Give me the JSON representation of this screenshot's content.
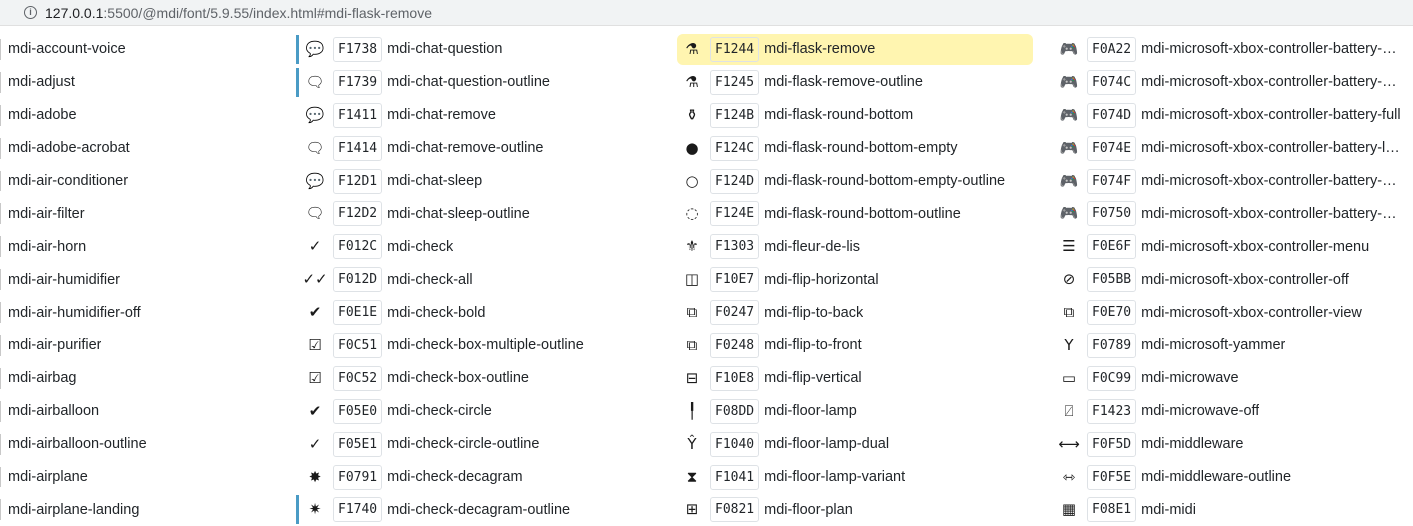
{
  "urlbar": {
    "host": "127.0.0.1",
    "rest": ":5500/@mdi/font/5.9.55/index.html#mdi-flask-remove",
    "info_icon": "info-icon"
  },
  "columns": [
    {
      "rows": [
        {
          "name": "mdi-account-voice"
        },
        {
          "name": "mdi-adjust"
        },
        {
          "name": "mdi-adobe"
        },
        {
          "name": "mdi-adobe-acrobat"
        },
        {
          "name": "mdi-air-conditioner"
        },
        {
          "name": "mdi-air-filter"
        },
        {
          "name": "mdi-air-horn"
        },
        {
          "name": "mdi-air-humidifier"
        },
        {
          "name": "mdi-air-humidifier-off"
        },
        {
          "name": "mdi-air-purifier"
        },
        {
          "name": "mdi-airbag"
        },
        {
          "name": "mdi-airballoon"
        },
        {
          "name": "mdi-airballoon-outline"
        },
        {
          "name": "mdi-airplane"
        },
        {
          "name": "mdi-airplane-landing"
        }
      ]
    },
    {
      "rows": [
        {
          "code": "F1738",
          "name": "mdi-chat-question",
          "glyph": "💬",
          "icon": "chat-question-icon",
          "marked": true
        },
        {
          "code": "F1739",
          "name": "mdi-chat-question-outline",
          "glyph": "🗨",
          "icon": "chat-question-outline-icon",
          "marked": true
        },
        {
          "code": "F1411",
          "name": "mdi-chat-remove",
          "glyph": "💬",
          "icon": "chat-remove-icon"
        },
        {
          "code": "F1414",
          "name": "mdi-chat-remove-outline",
          "glyph": "🗨",
          "icon": "chat-remove-outline-icon"
        },
        {
          "code": "F12D1",
          "name": "mdi-chat-sleep",
          "glyph": "💬",
          "icon": "chat-sleep-icon"
        },
        {
          "code": "F12D2",
          "name": "mdi-chat-sleep-outline",
          "glyph": "🗨",
          "icon": "chat-sleep-outline-icon"
        },
        {
          "code": "F012C",
          "name": "mdi-check",
          "glyph": "✓",
          "icon": "check-icon"
        },
        {
          "code": "F012D",
          "name": "mdi-check-all",
          "glyph": "✓✓",
          "icon": "check-all-icon"
        },
        {
          "code": "F0E1E",
          "name": "mdi-check-bold",
          "glyph": "✔",
          "icon": "check-bold-icon"
        },
        {
          "code": "F0C51",
          "name": "mdi-check-box-multiple-outline",
          "glyph": "☑",
          "icon": "check-box-multiple-outline-icon"
        },
        {
          "code": "F0C52",
          "name": "mdi-check-box-outline",
          "glyph": "☑",
          "icon": "check-box-outline-icon"
        },
        {
          "code": "F05E0",
          "name": "mdi-check-circle",
          "glyph": "✔",
          "icon": "check-circle-icon"
        },
        {
          "code": "F05E1",
          "name": "mdi-check-circle-outline",
          "glyph": "✓",
          "icon": "check-circle-outline-icon"
        },
        {
          "code": "F0791",
          "name": "mdi-check-decagram",
          "glyph": "✸",
          "icon": "check-decagram-icon"
        },
        {
          "code": "F1740",
          "name": "mdi-check-decagram-outline",
          "glyph": "✷",
          "icon": "check-decagram-outline-icon",
          "marked": true
        }
      ]
    },
    {
      "rows": [
        {
          "code": "F1244",
          "name": "mdi-flask-remove",
          "glyph": "⚗",
          "icon": "flask-remove-icon",
          "highlight": true
        },
        {
          "code": "F1245",
          "name": "mdi-flask-remove-outline",
          "glyph": "⚗",
          "icon": "flask-remove-outline-icon"
        },
        {
          "code": "F124B",
          "name": "mdi-flask-round-bottom",
          "glyph": "⚱",
          "icon": "flask-round-bottom-icon"
        },
        {
          "code": "F124C",
          "name": "mdi-flask-round-bottom-empty",
          "glyph": "●",
          "icon": "flask-round-bottom-empty-icon"
        },
        {
          "code": "F124D",
          "name": "mdi-flask-round-bottom-empty-outline",
          "glyph": "○",
          "icon": "flask-round-bottom-empty-outline-icon"
        },
        {
          "code": "F124E",
          "name": "mdi-flask-round-bottom-outline",
          "glyph": "◌",
          "icon": "flask-round-bottom-outline-icon"
        },
        {
          "code": "F1303",
          "name": "mdi-fleur-de-lis",
          "glyph": "⚜",
          "icon": "fleur-de-lis-icon"
        },
        {
          "code": "F10E7",
          "name": "mdi-flip-horizontal",
          "glyph": "◫",
          "icon": "flip-horizontal-icon"
        },
        {
          "code": "F0247",
          "name": "mdi-flip-to-back",
          "glyph": "⧉",
          "icon": "flip-to-back-icon"
        },
        {
          "code": "F0248",
          "name": "mdi-flip-to-front",
          "glyph": "⧉",
          "icon": "flip-to-front-icon"
        },
        {
          "code": "F10E8",
          "name": "mdi-flip-vertical",
          "glyph": "⊟",
          "icon": "flip-vertical-icon"
        },
        {
          "code": "F08DD",
          "name": "mdi-floor-lamp",
          "glyph": "╿",
          "icon": "floor-lamp-icon"
        },
        {
          "code": "F1040",
          "name": "mdi-floor-lamp-dual",
          "glyph": "Ŷ",
          "icon": "floor-lamp-dual-icon"
        },
        {
          "code": "F1041",
          "name": "mdi-floor-lamp-variant",
          "glyph": "⧗",
          "icon": "floor-lamp-variant-icon"
        },
        {
          "code": "F0821",
          "name": "mdi-floor-plan",
          "glyph": "⊞",
          "icon": "floor-plan-icon"
        }
      ]
    },
    {
      "rows": [
        {
          "code": "F0A22",
          "name": "mdi-microsoft-xbox-controller-battery-ch...",
          "glyph": "🎮",
          "icon": "xbox-controller-battery-charging-icon"
        },
        {
          "code": "F074C",
          "name": "mdi-microsoft-xbox-controller-battery-em...",
          "glyph": "🎮",
          "icon": "xbox-controller-battery-empty-icon"
        },
        {
          "code": "F074D",
          "name": "mdi-microsoft-xbox-controller-battery-full",
          "glyph": "🎮",
          "icon": "xbox-controller-battery-full-icon"
        },
        {
          "code": "F074E",
          "name": "mdi-microsoft-xbox-controller-battery-low",
          "glyph": "🎮",
          "icon": "xbox-controller-battery-low-icon"
        },
        {
          "code": "F074F",
          "name": "mdi-microsoft-xbox-controller-battery-me...",
          "glyph": "🎮",
          "icon": "xbox-controller-battery-medium-icon"
        },
        {
          "code": "F0750",
          "name": "mdi-microsoft-xbox-controller-battery-un...",
          "glyph": "🎮",
          "icon": "xbox-controller-battery-unknown-icon"
        },
        {
          "code": "F0E6F",
          "name": "mdi-microsoft-xbox-controller-menu",
          "glyph": "☰",
          "icon": "xbox-controller-menu-icon"
        },
        {
          "code": "F05BB",
          "name": "mdi-microsoft-xbox-controller-off",
          "glyph": "⊘",
          "icon": "xbox-controller-off-icon"
        },
        {
          "code": "F0E70",
          "name": "mdi-microsoft-xbox-controller-view",
          "glyph": "⧉",
          "icon": "xbox-controller-view-icon"
        },
        {
          "code": "F0789",
          "name": "mdi-microsoft-yammer",
          "glyph": "Y",
          "icon": "microsoft-yammer-icon"
        },
        {
          "code": "F0C99",
          "name": "mdi-microwave",
          "glyph": "▭",
          "icon": "microwave-icon"
        },
        {
          "code": "F1423",
          "name": "mdi-microwave-off",
          "glyph": "⍁",
          "icon": "microwave-off-icon"
        },
        {
          "code": "F0F5D",
          "name": "mdi-middleware",
          "glyph": "⟷",
          "icon": "middleware-icon"
        },
        {
          "code": "F0F5E",
          "name": "mdi-middleware-outline",
          "glyph": "⇿",
          "icon": "middleware-outline-icon"
        },
        {
          "code": "F08E1",
          "name": "mdi-midi",
          "glyph": "▦",
          "icon": "midi-icon"
        }
      ]
    }
  ]
}
